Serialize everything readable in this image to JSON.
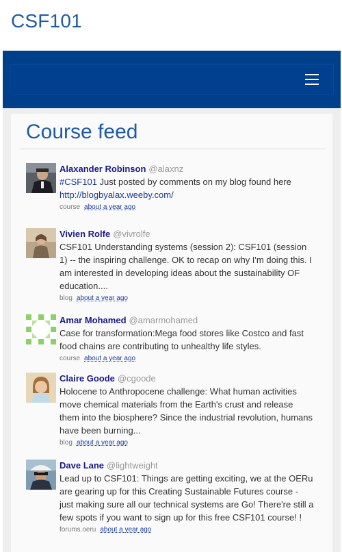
{
  "site": {
    "title": "CSF101"
  },
  "nav": {
    "menu_icon": "hamburger-menu-icon"
  },
  "feed": {
    "heading": "Course feed",
    "items": [
      {
        "name": "Alaxander Robinson",
        "handle": "@alaxnz",
        "text_parts": [
          "#CSF101",
          " Just posted by comments on my blog found here ",
          "http://blogbyalax.weeby.com/"
        ],
        "source": "course",
        "time": "about a year ago"
      },
      {
        "name": "Vivien Rolfe",
        "handle": "@vivrolfe",
        "text": "CSF101 Understanding systems (session 2): CSF101 (session 1) -- the inspiring challenge. OK to recap on why I'm doing this. I am interested in developing ideas about the sustainability OF education....",
        "source": "blog",
        "time": "about a year ago"
      },
      {
        "name": "Amar Mohamed",
        "handle": "@amarmohamed",
        "text": "Case for transformation:Mega food stores like Costco and fast food chains are contributing to unhealthy life styles.",
        "source": "course",
        "time": "about a year ago"
      },
      {
        "name": "Claire Goode",
        "handle": "@cgoode",
        "text": "Holocene to Anthropocene challenge: What human activities move chemical materials from the Earth's crust and release them into the biosphere? Since the industrial revolution, humans have been burning...",
        "source": "blog",
        "time": "about a year ago"
      },
      {
        "name": "Dave Lane",
        "handle": "@lightweight",
        "text": "Lead up to CSF101: Things are getting exciting, we at the OERu are gearing up for this Creating Sustainable Futures course - just making sure all our technical systems are Go! There're still a few spots if you want to sign up for this free CSF101 course! !",
        "source": "forums.oeru",
        "time": "about a year ago"
      }
    ]
  }
}
